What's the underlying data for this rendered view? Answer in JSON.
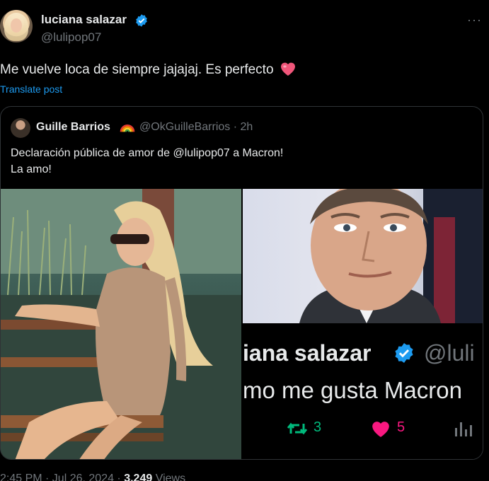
{
  "author": {
    "display_name": "luciana salazar",
    "handle": "@lulipop07",
    "verified_icon": "verified-badge-icon",
    "more_label": "···"
  },
  "tweet": {
    "text": "Me vuelve loca de siempre jajajaj. Es perfecto",
    "emoji": "pink-heart-emoji",
    "translate_label": "Translate post"
  },
  "quote": {
    "display_name": "Guille Barrios",
    "emoji": "rainbow-emoji",
    "handle": "@OkGuilleBarrios",
    "separator": "·",
    "time": "2h",
    "text_line1": "Declaración pública de amor de @lulipop07 a Macron!",
    "text_line2": "La amo!"
  },
  "screenshot": {
    "name_fragment": "iana salazar",
    "handle_fragment": "@luli",
    "text_fragment": "mo me gusta Macron",
    "retweets": "3",
    "likes": "5"
  },
  "footer": {
    "time": "2:45 PM · Jul 26, 2024 · ",
    "views_count": "3,249",
    "views_label": " Views"
  },
  "colors": {
    "accent": "#1d9bf0",
    "retweet": "#00ba7c",
    "like": "#f91880",
    "muted": "#71767b"
  }
}
